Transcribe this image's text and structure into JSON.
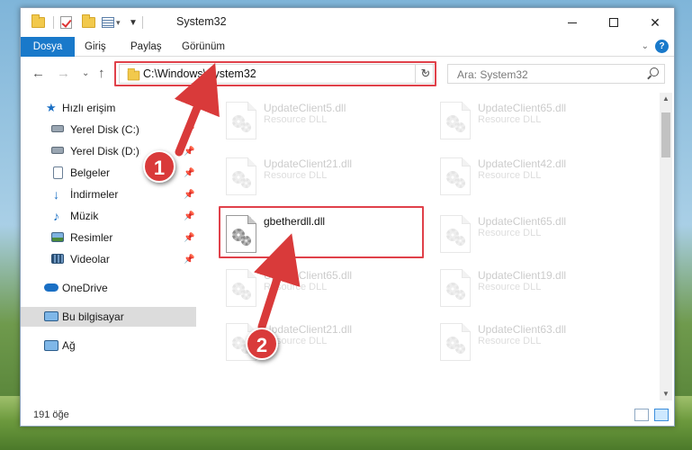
{
  "window": {
    "title": "System32",
    "minimize_label": "—",
    "maximize_label": "",
    "close_label": "✕"
  },
  "ribbon": {
    "tabs": [
      "Dosya",
      "Giriş",
      "Paylaş",
      "Görünüm"
    ],
    "help_label": "?"
  },
  "address": {
    "path": "C:\\Windows\\System32",
    "search_placeholder": "Ara: System32"
  },
  "sidebar": {
    "quick_access": "Hızlı erişim",
    "items": [
      {
        "label": "Yerel Disk (C:)",
        "icon": "drive-icon"
      },
      {
        "label": "Yerel Disk (D:)",
        "icon": "drive-icon"
      },
      {
        "label": "Belgeler",
        "icon": "documents-icon"
      },
      {
        "label": "İndirmeler",
        "icon": "downloads-icon"
      },
      {
        "label": "Müzik",
        "icon": "music-icon"
      },
      {
        "label": "Resimler",
        "icon": "pictures-icon"
      },
      {
        "label": "Videolar",
        "icon": "videos-icon"
      }
    ],
    "onedrive": "OneDrive",
    "this_pc": "Bu bilgisayar",
    "network": "Ağ"
  },
  "files": {
    "type_label": "Resource DLL",
    "left_column": [
      "UpdateClient5.dll",
      "UpdateClient21.dll",
      "gbetherdll.dll",
      "UpdateClient65.dll",
      "UpdateClient21.dll"
    ],
    "right_column": [
      "UpdateClient65.dll",
      "UpdateClient42.dll",
      "UpdateClient65.dll",
      "UpdateClient19.dll",
      "UpdateClient63.dll"
    ],
    "highlighted": "gbetherdll.dll"
  },
  "markers": [
    "1",
    "2"
  ],
  "status": {
    "item_count": "191 öğe"
  },
  "colors": {
    "accent": "#1979ca",
    "highlight": "#e0414a",
    "marker": "#d93a3a",
    "selected_nav": "#dcdcdc"
  }
}
